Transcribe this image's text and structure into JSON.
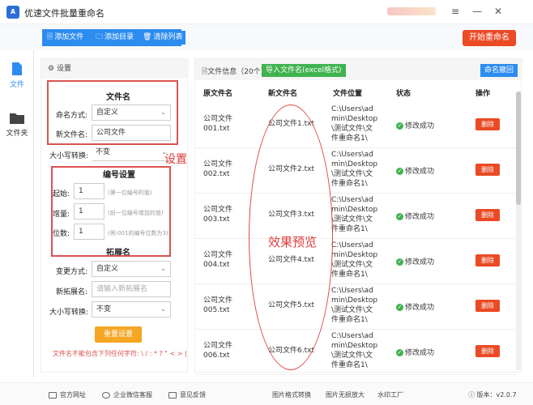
{
  "window": {
    "title": "优速文件批量重命名",
    "logo_text": "A"
  },
  "toolbar": {
    "add_file": "添加文件",
    "add_folder": "添加目录",
    "clear_list": "清除列表",
    "start": "开始重命名"
  },
  "nav": {
    "file": "文件",
    "folder": "文件夹"
  },
  "settings": {
    "header": "设置",
    "file_name_section": "文件名",
    "naming_mode_label": "命名方式:",
    "naming_mode_value": "自定义",
    "new_name_label": "新文件名:",
    "new_name_value": "公司文件",
    "case_label": "大小写转换:",
    "case_value": "不变",
    "annotation": "设置",
    "number_section": "编号设置",
    "start_label": "起始:",
    "start_value": "1",
    "start_hint": "(第一位编号的值)",
    "step_label": "增量:",
    "step_value": "1",
    "step_hint": "(前一位编号增加的值)",
    "digits_label": "位数:",
    "digits_value": "1",
    "digits_hint": "(例:001的编号位数为3)",
    "ext_section": "拓展名",
    "ext_mode_label": "变更方式:",
    "ext_mode_value": "自定义",
    "new_ext_label": "新拓展名:",
    "new_ext_placeholder": "请输入新拓展名",
    "ext_case_label": "大小写转换:",
    "ext_case_value": "不变",
    "reset": "重置设置",
    "warning": "文件名不能包含下列任何字符: \\ / : * ? \" < > |"
  },
  "main": {
    "info_label": "文件信息（20个）",
    "import_btn": "导入文件名(excel格式)",
    "undo_btn": "命名撤回",
    "headers": [
      "原文件名",
      "新文件名",
      "文件位置",
      "状态",
      "操作"
    ],
    "preview_annotation": "效果预览",
    "rows": [
      {
        "orig": "公司文件001.txt",
        "new": "公司文件1.txt",
        "path": "C:\\Users\\admin\\Desktop\\测试文件\\文件重命名1\\",
        "status": "修改成功",
        "action": "删除"
      },
      {
        "orig": "公司文件002.txt",
        "new": "公司文件2.txt",
        "path": "C:\\Users\\admin\\Desktop\\测试文件\\文件重命名1\\",
        "status": "修改成功",
        "action": "删除"
      },
      {
        "orig": "公司文件003.txt",
        "new": "公司文件3.txt",
        "path": "C:\\Users\\admin\\Desktop\\测试文件\\文件重命名1\\",
        "status": "修改成功",
        "action": "删除"
      },
      {
        "orig": "公司文件004.txt",
        "new": "公司文件4.txt",
        "path": "C:\\Users\\admin\\Desktop\\测试文件\\文件重命名1\\",
        "status": "修改成功",
        "action": "删除"
      },
      {
        "orig": "公司文件005.txt",
        "new": "公司文件5.txt",
        "path": "C:\\Users\\admin\\Desktop\\测试文件\\文件重命名1\\",
        "status": "修改成功",
        "action": "删除"
      },
      {
        "orig": "公司文件006.txt",
        "new": "公司文件6.txt",
        "path": "C:\\Users\\admin\\Desktop\\测试文件\\文件重命名1\\",
        "status": "修改成功",
        "action": "删除"
      }
    ]
  },
  "footer": {
    "site": "官方网址",
    "wechat": "企业微信客服",
    "feedback": "意见反馈",
    "img_convert": "图片格式转换",
    "img_enlarge": "图片无损放大",
    "watermark": "水印工厂",
    "version": "版本：v2.0.7"
  }
}
